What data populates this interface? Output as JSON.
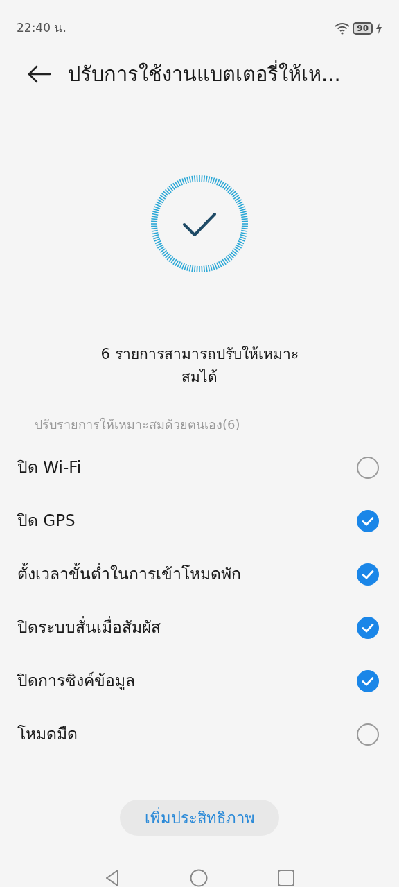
{
  "status_bar": {
    "time": "22:40 น.",
    "battery": "90",
    "charging": true
  },
  "header": {
    "title": "ปรับการใช้งานแบตเตอรี่ให้เห..."
  },
  "summary": "6 รายการสามารถปรับให้เหมาะสมได้",
  "section_label": "ปรับรายการให้เหมาะสมด้วยตนเอง(6)",
  "items": [
    {
      "label": "ปิด Wi-Fi",
      "checked": false
    },
    {
      "label": "ปิด GPS",
      "checked": true
    },
    {
      "label": "ตั้งเวลาขั้นต่ำในการเข้าโหมดพัก",
      "checked": true
    },
    {
      "label": "ปิดระบบสั่นเมื่อสัมผัส",
      "checked": true
    },
    {
      "label": "ปิดการซิงค์ข้อมูล",
      "checked": true
    },
    {
      "label": "โหมดมืด",
      "checked": false
    }
  ],
  "action_button": "เพิ่มประสิทธิภาพ"
}
